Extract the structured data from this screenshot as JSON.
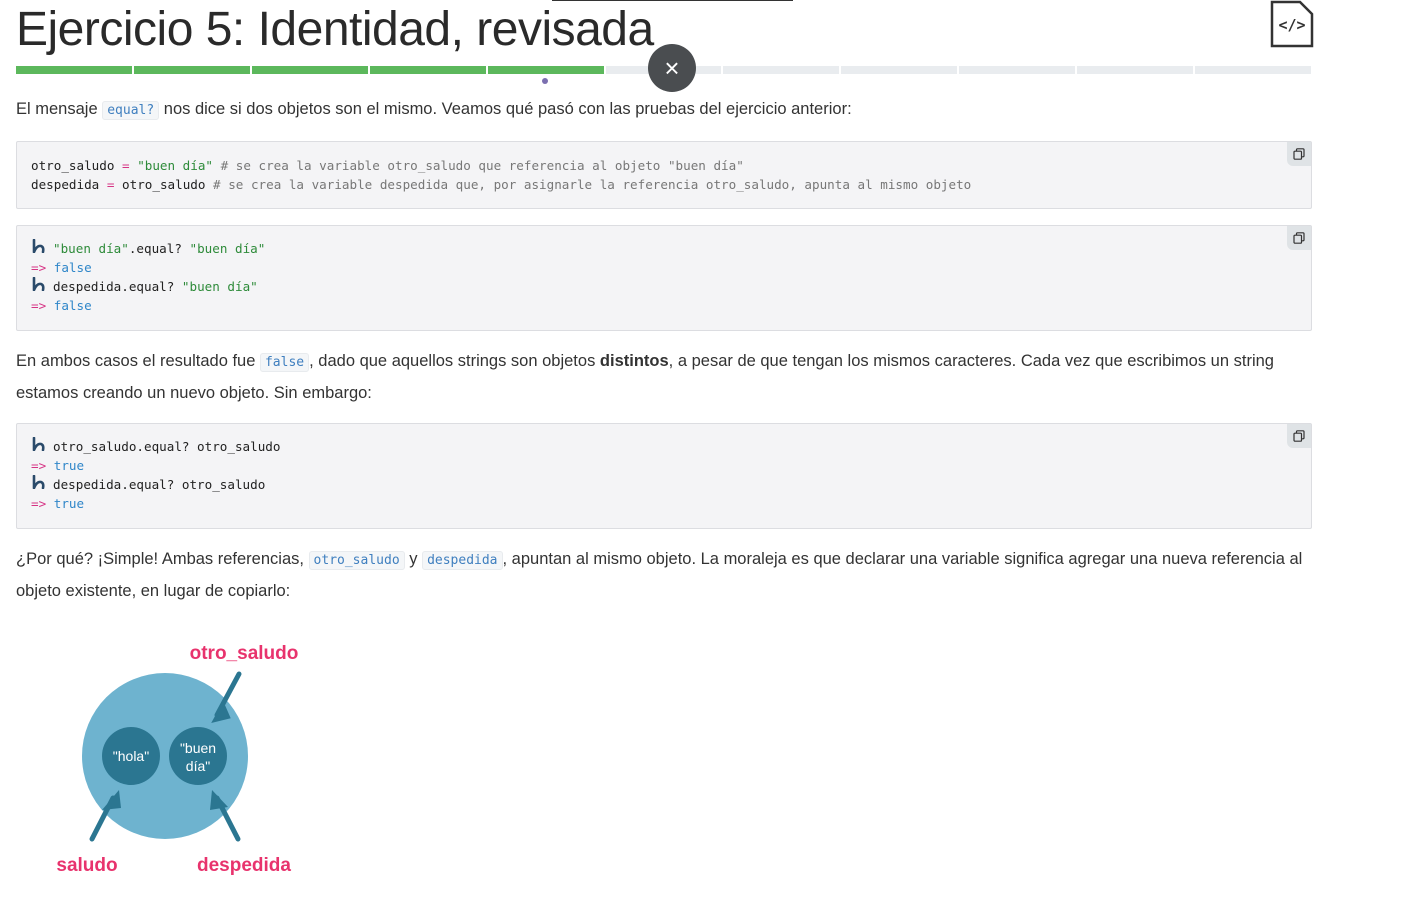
{
  "page": {
    "title": "Ejercicio 5: Identidad, revisada"
  },
  "progress": {
    "segments_total": 11,
    "segments_done": 5
  },
  "icons": {
    "code_file": "code-file-icon",
    "close": "close-icon",
    "copy": "copy-icon",
    "prompt": "prompt-icon"
  },
  "close_button": {
    "label": "×"
  },
  "para1": {
    "before": "El mensaje ",
    "code": "equal?",
    "after": " nos dice si dos objetos son el mismo. Veamos qué pasó con las pruebas del ejercicio anterior:"
  },
  "code1": {
    "line1": {
      "var": "otro_saludo",
      "op": "=",
      "str": "\"buen día\"",
      "comment": "# se crea la variable otro_saludo que referencia al objeto \"buen día\""
    },
    "line2": {
      "var": "despedida",
      "op": "=",
      "ref": "otro_saludo",
      "comment": "# se crea la variable despedida que, por asignarle la referencia otro_saludo, apunta al mismo objeto"
    }
  },
  "code2": {
    "l1_str1": "\"buen día\"",
    "l1_mid": ".equal? ",
    "l1_str2": "\"buen día\"",
    "r1": "false",
    "l2_mid": "despedida.equal? ",
    "l2_str": "\"buen día\"",
    "r2": "false",
    "arrow": "=>"
  },
  "para2": {
    "before": "En ambos casos el resultado fue ",
    "code": "false",
    "middle": ", dado que aquellos strings son objetos ",
    "bold": "distintos",
    "after": ", a pesar de que tengan los mismos caracteres. Cada vez que escribimos un string estamos creando un nuevo objeto. Sin embargo:"
  },
  "code3": {
    "l1": "otro_saludo.equal? otro_saludo",
    "r1": "true",
    "l2": "despedida.equal? otro_saludo",
    "r2": "true",
    "arrow": "=>"
  },
  "para3": {
    "before": "¿Por qué? ¡Simple! Ambas referencias, ",
    "code1": "otro_saludo",
    "mid": " y ",
    "code2": "despedida",
    "after": ", apuntan al mismo objeto. La moraleja es que declarar una variable significa agregar una nueva referencia al objeto existente, en lugar de copiarlo:"
  },
  "diagram": {
    "label_top": "otro_saludo",
    "label_left": "saludo",
    "label_right": "despedida",
    "obj1": "\"hola\"",
    "obj2_line1": "\"buen",
    "obj2_line2": "día\"",
    "colors": {
      "outer": "#6eb3cf",
      "inner": "#2b7691",
      "label": "#e8336d",
      "arrow": "#2b7691"
    }
  }
}
